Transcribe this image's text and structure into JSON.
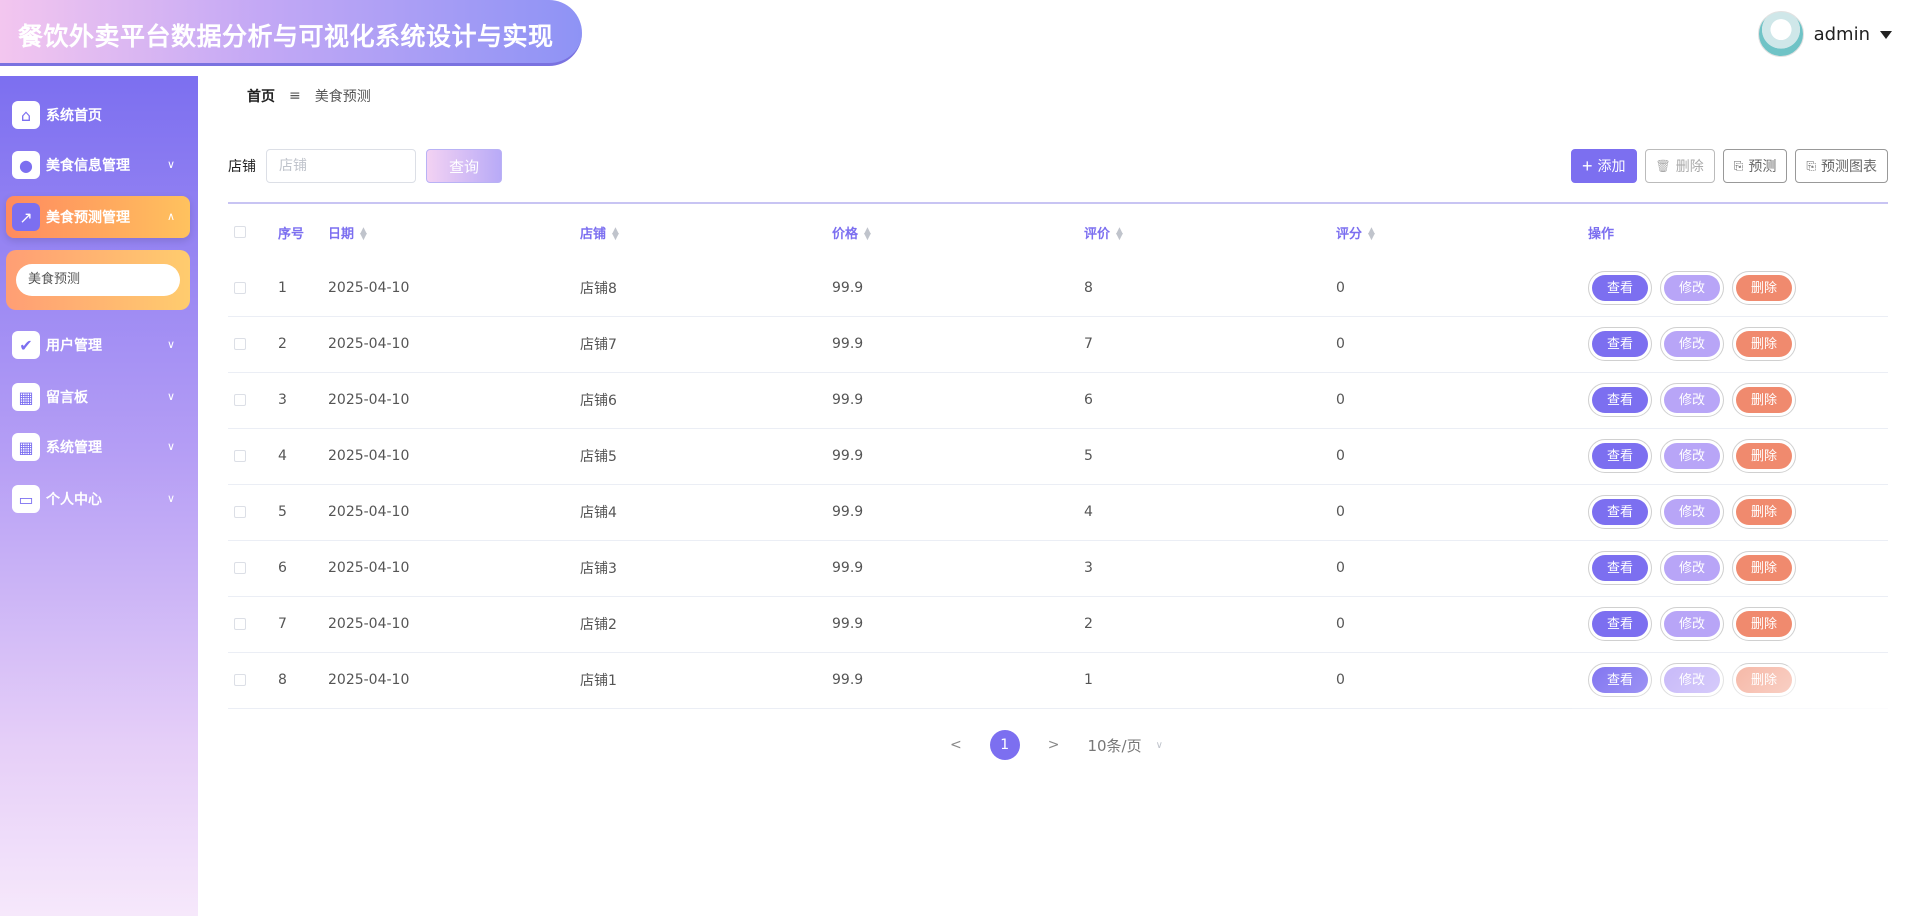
{
  "header": {
    "title": "餐饮外卖平台数据分析与可视化系统设计与实现",
    "username": "admin"
  },
  "sidebar": {
    "items": [
      {
        "label": "系统首页",
        "icon": "home-icon",
        "has_chevron": false
      },
      {
        "label": "美食信息管理",
        "icon": "lightbulb-icon",
        "has_chevron": true
      },
      {
        "label": "美食预测管理",
        "icon": "chart-icon",
        "has_chevron": true,
        "active": true
      },
      {
        "label": "用户管理",
        "icon": "clipboard-icon",
        "has_chevron": true
      },
      {
        "label": "留言板",
        "icon": "grid-icon",
        "has_chevron": true
      },
      {
        "label": "系统管理",
        "icon": "grid-icon",
        "has_chevron": true
      },
      {
        "label": "个人中心",
        "icon": "card-icon",
        "has_chevron": true
      }
    ],
    "submenu": {
      "label": "美食预测"
    }
  },
  "breadcrumb": {
    "home": "首页",
    "separator": "≡",
    "current": "美食预测"
  },
  "search": {
    "label": "店铺",
    "placeholder": "店铺",
    "value": "",
    "button": "查询"
  },
  "toolbar": {
    "add": "添加",
    "delete": "删除",
    "predict": "预测",
    "predict_chart": "预测图表"
  },
  "table": {
    "columns": [
      "序号",
      "日期",
      "店铺",
      "价格",
      "评价",
      "评分",
      "操作"
    ],
    "rows": [
      {
        "no": "1",
        "date": "2025-04-10",
        "shop": "店铺8",
        "price": "99.9",
        "review": "8",
        "score": "0"
      },
      {
        "no": "2",
        "date": "2025-04-10",
        "shop": "店铺7",
        "price": "99.9",
        "review": "7",
        "score": "0"
      },
      {
        "no": "3",
        "date": "2025-04-10",
        "shop": "店铺6",
        "price": "99.9",
        "review": "6",
        "score": "0"
      },
      {
        "no": "4",
        "date": "2025-04-10",
        "shop": "店铺5",
        "price": "99.9",
        "review": "5",
        "score": "0"
      },
      {
        "no": "5",
        "date": "2025-04-10",
        "shop": "店铺4",
        "price": "99.9",
        "review": "4",
        "score": "0"
      },
      {
        "no": "6",
        "date": "2025-04-10",
        "shop": "店铺3",
        "price": "99.9",
        "review": "3",
        "score": "0"
      },
      {
        "no": "7",
        "date": "2025-04-10",
        "shop": "店铺2",
        "price": "99.9",
        "review": "2",
        "score": "0"
      },
      {
        "no": "8",
        "date": "2025-04-10",
        "shop": "店铺1",
        "price": "99.9",
        "review": "1",
        "score": "0"
      }
    ],
    "actions": {
      "view": "查看",
      "edit": "修改",
      "delete": "删除"
    }
  },
  "pagination": {
    "prev": "<",
    "current": "1",
    "next": ">",
    "page_size": "10条/页"
  },
  "colors": {
    "accent": "#7c6ff0",
    "edit": "#b8a5f7",
    "delete": "#f08a6e",
    "active_menu": "#ff8a5f"
  }
}
